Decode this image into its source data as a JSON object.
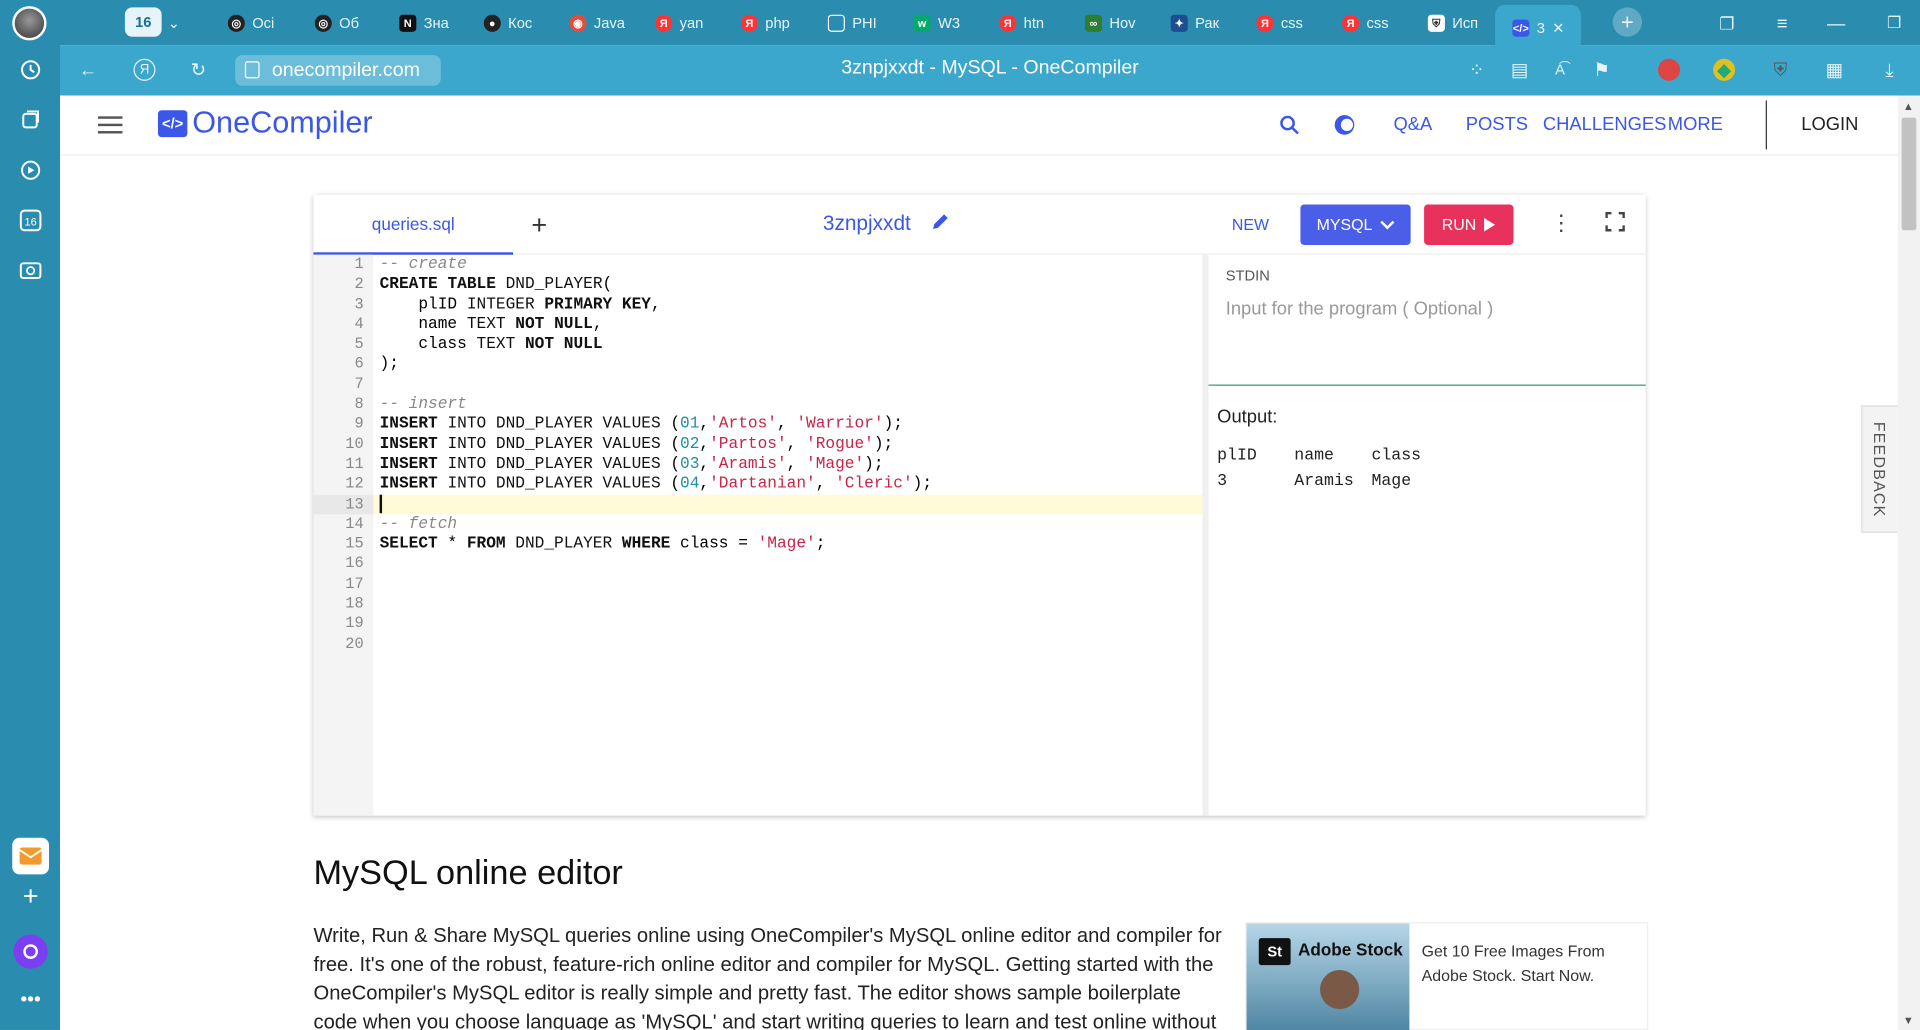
{
  "browser": {
    "tab_count": "16",
    "tabs": [
      "Осі",
      "Об",
      "Зна",
      "Кос",
      "Java",
      "yan",
      "php",
      "PHI",
      "W3",
      "htn",
      "Hov",
      "Рак",
      "css",
      "css",
      "Исп",
      "3"
    ],
    "url": "onecompiler.com",
    "page_title": "3znpjxxdt - MySQL - OneCompiler"
  },
  "site": {
    "logo_text": "OneCompiler",
    "logo_mark": "</>",
    "nav": [
      "Q&A",
      "POSTS",
      "CHALLENGES",
      "MORE"
    ],
    "login": "LOGIN"
  },
  "editor": {
    "file_tab": "queries.sql",
    "project_name": "3znpjxxdt",
    "new_label": "NEW",
    "language_label": "MYSQL",
    "run_label": "RUN",
    "stdin_label": "STDIN",
    "stdin_placeholder": "Input for the program ( Optional )",
    "output_label": "Output:",
    "output_headers": [
      "plID",
      "name",
      "class"
    ],
    "output_rows": [
      [
        "3",
        "Aramis",
        "Mage"
      ]
    ],
    "code_lines": [
      "-- create",
      "CREATE TABLE DND_PLAYER(",
      "    plID INTEGER PRIMARY KEY,",
      "    name TEXT NOT NULL,",
      "    class TEXT NOT NULL",
      ");",
      "",
      "-- insert",
      "INSERT INTO DND_PLAYER VALUES (01,'Artos', 'Warrior');",
      "INSERT INTO DND_PLAYER VALUES (02,'Partos', 'Rogue');",
      "INSERT INTO DND_PLAYER VALUES (03,'Aramis', 'Mage');",
      "INSERT INTO DND_PLAYER VALUES (04,'Dartanian', 'Cleric');",
      "",
      "-- fetch",
      "SELECT * FROM DND_PLAYER WHERE class = 'Mage';",
      "",
      "",
      "",
      "",
      ""
    ]
  },
  "content": {
    "heading": "MySQL online editor",
    "paragraph": "Write, Run & Share MySQL queries online using OneCompiler's MySQL online editor and compiler for free. It's one of the robust, feature-rich online editor and compiler for MySQL. Getting started with the OneCompiler's MySQL editor is really simple and pretty fast. The editor shows sample boilerplate code when you choose language as 'MySQL' and start writing queries to learn and test online without worrying",
    "ad_badge": "St",
    "ad_brand": "Adobe Stock",
    "ad_text": "Get 10 Free Images From Adobe Stock. Start Now."
  },
  "feedback_label": "FEEDBACK",
  "colors": {
    "browser_blue": "#2a8db0",
    "brand_blue": "#3a57e8",
    "run_red": "#e8315b"
  }
}
